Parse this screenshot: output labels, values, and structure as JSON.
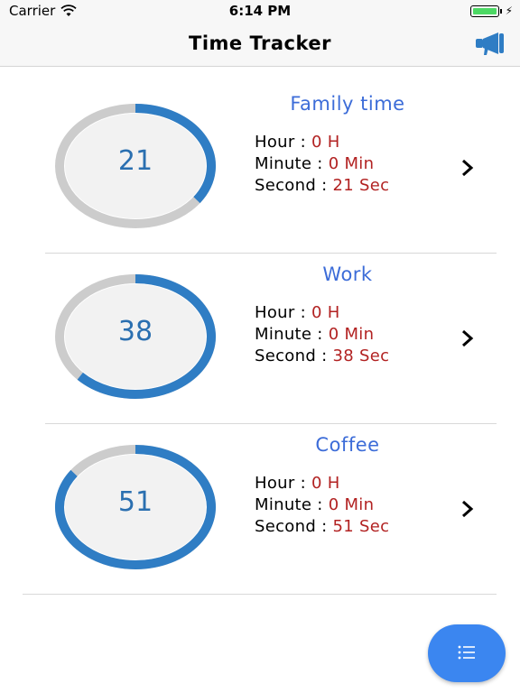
{
  "status_bar": {
    "carrier": "Carrier",
    "time": "6:14 PM",
    "battery_level": 1.0
  },
  "nav": {
    "title": "Time Tracker",
    "right_icon": "megaphone-icon"
  },
  "trackers": [
    {
      "name": "Family time",
      "seconds_total": 21,
      "progress": 0.35,
      "center_value": "21",
      "hour_label": "Hour :",
      "hour_value": "0 H",
      "minute_label": "Minute :",
      "minute_value": "0 Min",
      "second_label": "Second :",
      "second_value": "21 Sec"
    },
    {
      "name": "Work",
      "seconds_total": 38,
      "progress": 0.63,
      "center_value": "38",
      "hour_label": "Hour :",
      "hour_value": "0 H",
      "minute_label": "Minute :",
      "minute_value": "0 Min",
      "second_label": "Second :",
      "second_value": "38 Sec"
    },
    {
      "name": "Coffee",
      "seconds_total": 51,
      "progress": 0.85,
      "center_value": "51",
      "hour_label": "Hour :",
      "hour_value": "0 H",
      "minute_label": "Minute :",
      "minute_value": "0 Min",
      "second_label": "Second :",
      "second_value": "51 Sec"
    }
  ],
  "fab": {
    "icon": "list-icon"
  },
  "colors": {
    "ring_progress": "#2f7dc4",
    "ring_track": "#cccccc",
    "ring_inner": "#f2f2f2",
    "title_blue": "#3c6cd8",
    "value_red": "#b22222",
    "fab": "#3b86f0"
  }
}
